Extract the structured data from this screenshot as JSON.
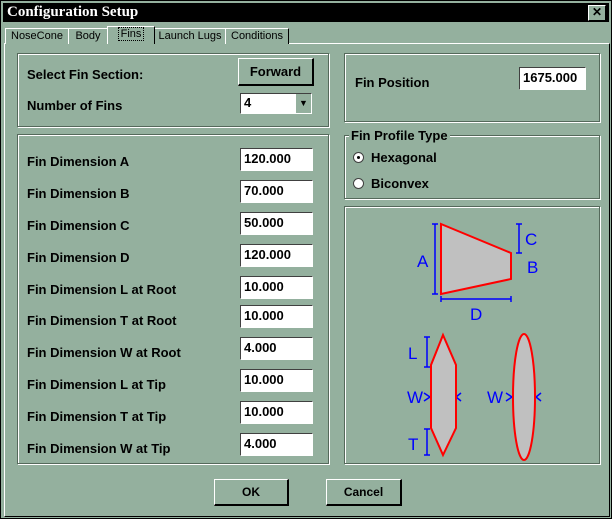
{
  "title": "Configuration Setup",
  "close_glyph": "✕",
  "tabs": [
    "NoseCone",
    "Body",
    "Fins",
    "Launch Lugs",
    "Conditions"
  ],
  "active_tab": "Fins",
  "fin_section": {
    "label": "Select Fin Section:",
    "button": "Forward"
  },
  "num_fins": {
    "label": "Number of Fins",
    "value": "4",
    "arrow": "▼"
  },
  "fin_position": {
    "label": "Fin Position",
    "value": "1675.000"
  },
  "dimensions": [
    {
      "label": "Fin Dimension A",
      "value": "120.000"
    },
    {
      "label": "Fin Dimension B",
      "value": "70.000"
    },
    {
      "label": "Fin Dimension C",
      "value": "50.000"
    },
    {
      "label": "Fin Dimension D",
      "value": "120.000"
    },
    {
      "label": "Fin Dimension L at Root",
      "value": "10.000"
    },
    {
      "label": "Fin Dimension T at Root",
      "value": "10.000"
    },
    {
      "label": "Fin Dimension W at Root",
      "value": "4.000"
    },
    {
      "label": "Fin Dimension L at Tip",
      "value": "10.000"
    },
    {
      "label": "Fin Dimension T at Tip",
      "value": "10.000"
    },
    {
      "label": "Fin Dimension W at Tip",
      "value": "4.000"
    }
  ],
  "profile": {
    "legend": "Fin Profile Type",
    "options": [
      "Hexagonal",
      "Biconvex"
    ],
    "selected": "Hexagonal"
  },
  "diagram": {
    "A": "A",
    "B": "B",
    "C": "C",
    "D": "D",
    "L": "L",
    "T": "T",
    "W": "W",
    "fin_fill": "#c0c0c0",
    "fin_stroke": "#ff0000",
    "dim_color": "#0000ff"
  },
  "buttons": {
    "ok": "OK",
    "cancel": "Cancel"
  },
  "colors": {
    "background": "#94b09e",
    "titlebar": "#000000"
  }
}
